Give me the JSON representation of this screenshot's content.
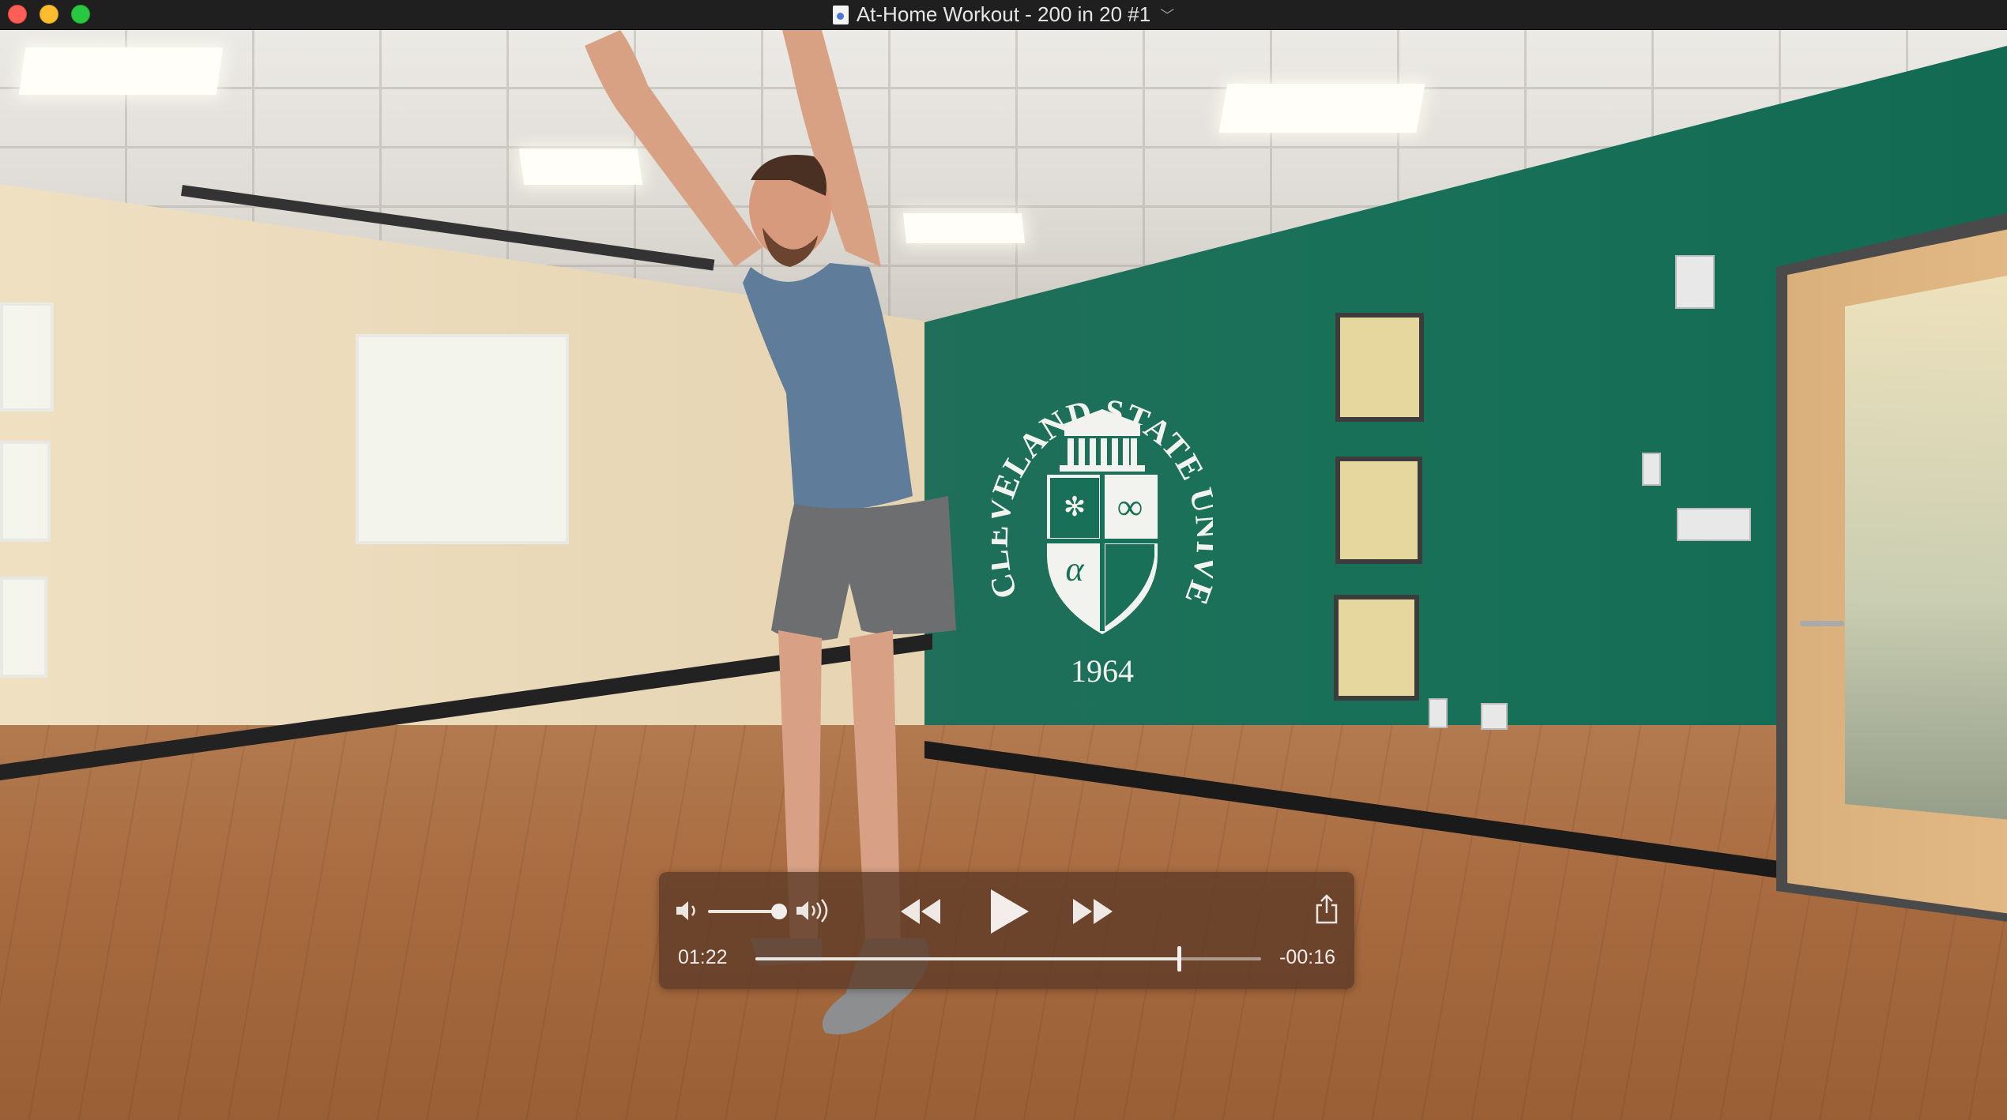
{
  "window": {
    "title": "At-Home Workout - 200 in 20 #1",
    "chevron": "﹀",
    "controls": [
      "close",
      "minimize",
      "zoom"
    ]
  },
  "player": {
    "elapsed": "01:22",
    "remaining": "-00:16",
    "progress": 0.837,
    "volume": 1.0,
    "icons": [
      "volume-low-icon",
      "volume-high-icon",
      "rewind-icon",
      "play-icon",
      "fast-forward-icon",
      "share-icon"
    ]
  },
  "scene": {
    "seal_ring_text": "CLEVELAND STATE UNIVERSITY",
    "seal_year": "1964",
    "seal_alpha": "α",
    "seal_infinity": "∞"
  },
  "colors": {
    "hud_bg": "#5f3c28",
    "wall_green": "#177057",
    "close": "#ff5f57",
    "minimize": "#febc2e",
    "zoom": "#28c840"
  }
}
